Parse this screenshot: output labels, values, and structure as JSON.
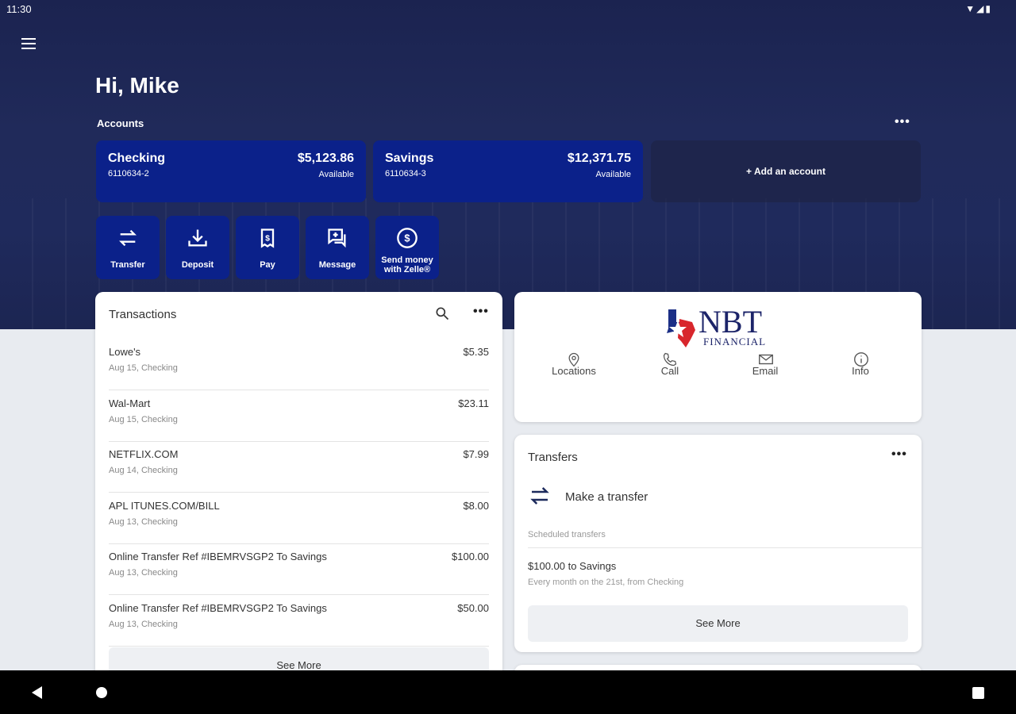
{
  "status": {
    "time": "11:30",
    "icons": "▼◢▮"
  },
  "greeting": "Hi, Mike",
  "accounts": {
    "label": "Accounts",
    "add": "+ Add an account",
    "items": [
      {
        "name": "Checking",
        "number": "6110634-2",
        "balance": "$5,123.86",
        "status": "Available"
      },
      {
        "name": "Savings",
        "number": "6110634-3",
        "balance": "$12,371.75",
        "status": "Available"
      }
    ]
  },
  "actions": [
    "Transfer",
    "Deposit",
    "Pay",
    "Message",
    "Send money with Zelle®"
  ],
  "transactions": {
    "title": "Transactions",
    "see_more": "See More",
    "items": [
      {
        "merchant": "Lowe's",
        "detail": "Aug 15, Checking",
        "amount": "$5.35"
      },
      {
        "merchant": "Wal-Mart",
        "detail": "Aug 15, Checking",
        "amount": "$23.11"
      },
      {
        "merchant": "NETFLIX.COM",
        "detail": "Aug 14, Checking",
        "amount": "$7.99"
      },
      {
        "merchant": "APL ITUNES.COM/BILL",
        "detail": "Aug 13, Checking",
        "amount": "$8.00"
      },
      {
        "merchant": "Online Transfer Ref #IBEMRVSGP2 To Savings",
        "detail": "Aug 13, Checking",
        "amount": "$100.00"
      },
      {
        "merchant": "Online Transfer Ref #IBEMRVSGP2 To Savings",
        "detail": "Aug 13, Checking",
        "amount": "$50.00"
      }
    ]
  },
  "bank": {
    "logo": "NBT",
    "logo_sub": "FINANCIAL",
    "links": [
      "Locations",
      "Call",
      "Email",
      "Info"
    ]
  },
  "transfers": {
    "title": "Transfers",
    "make": "Make a transfer",
    "scheduled": "Scheduled transfers",
    "item_title": "$100.00 to Savings",
    "item_detail": "Every month on the 21st, from Checking",
    "see_more": "See More"
  },
  "colors": {
    "accent": "#0b218a",
    "hero": "#1f2a5c"
  }
}
